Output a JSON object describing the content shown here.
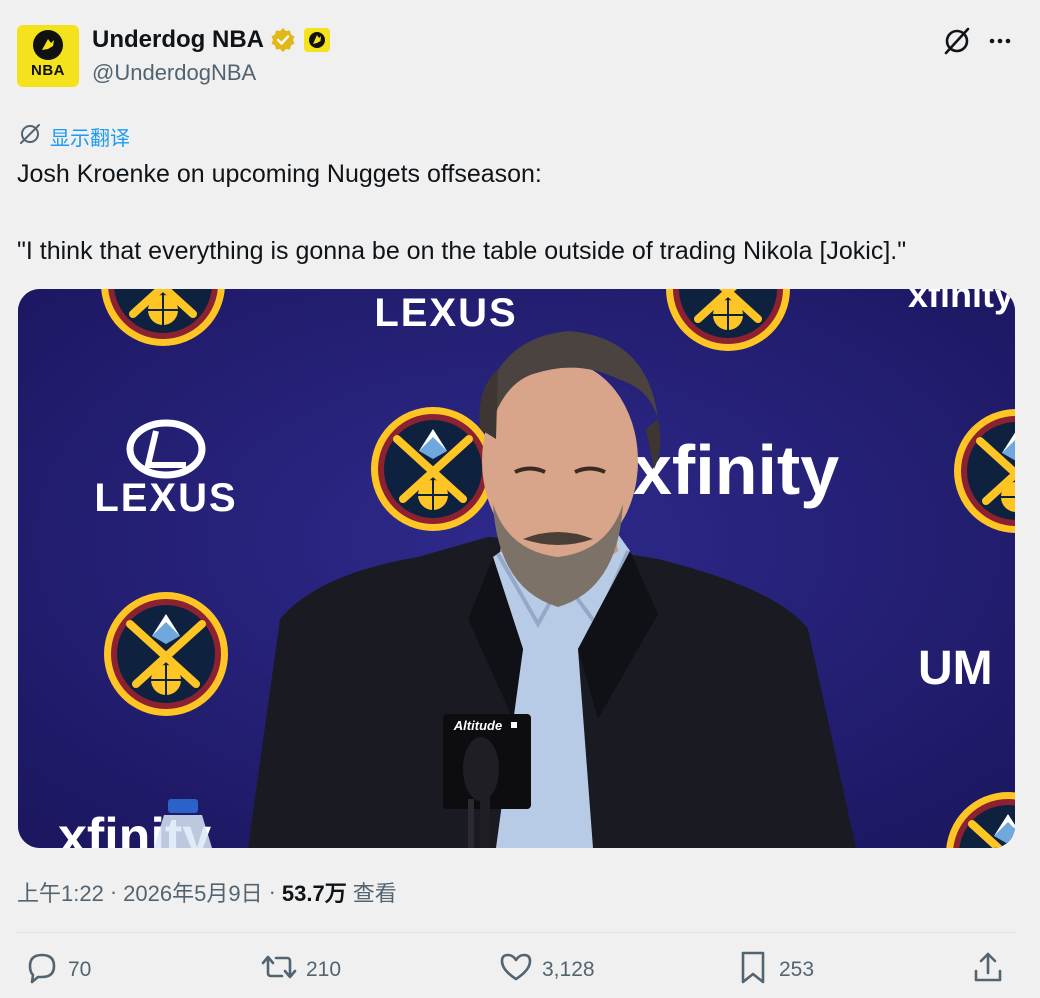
{
  "author": {
    "display_name": "Underdog NBA",
    "handle": "@UnderdogNBA",
    "avatar_text": "NBA"
  },
  "translate_label": "显示翻译",
  "tweet": {
    "line1": "Josh Kroenke on upcoming Nuggets offseason:",
    "line2": "\"I think that everything is gonna be on the table outside of trading Nikola [Jokic].\""
  },
  "media": {
    "sponsor_1": "LEXUS",
    "sponsor_2": "xfinity",
    "sponsor_3": "UM",
    "mic_brand": "Altitude"
  },
  "meta": {
    "time": "上午1:22",
    "date": "2026年5月9日",
    "views_count": "53.7万",
    "views_label": "查看",
    "sep": "·"
  },
  "actions": {
    "replies": "70",
    "retweets": "210",
    "likes": "3,128",
    "bookmarks": "253"
  },
  "colors": {
    "accent": "#1d9bf0",
    "brand_yellow": "#f4e21c",
    "backdrop_navy": "#241e78",
    "verified_gold": "#e2b719"
  },
  "icons": [
    "grok-icon",
    "more-icon",
    "translate-icon",
    "reply-icon",
    "retweet-icon",
    "like-icon",
    "bookmark-icon",
    "share-icon",
    "verified-badge-icon"
  ]
}
